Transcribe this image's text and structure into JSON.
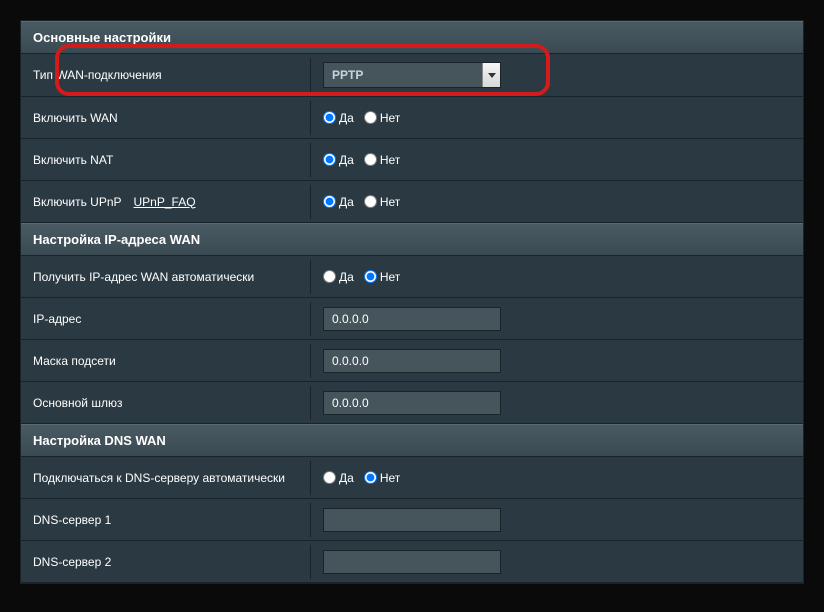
{
  "sections": {
    "basic": {
      "title": "Основные настройки",
      "rows": {
        "wan_type": {
          "label": "Тип WAN-подключения",
          "value": "PPTP"
        },
        "enable_wan": {
          "label": "Включить WAN",
          "yes": "Да",
          "no": "Нет"
        },
        "enable_nat": {
          "label": "Включить NAT",
          "yes": "Да",
          "no": "Нет"
        },
        "enable_upnp": {
          "label": "Включить UPnP",
          "faq_link": "UPnP_FAQ",
          "yes": "Да",
          "no": "Нет"
        }
      }
    },
    "wan_ip": {
      "title": "Настройка IP-адреса WAN",
      "rows": {
        "auto_ip": {
          "label": "Получить IP-адрес WAN автоматически",
          "yes": "Да",
          "no": "Нет"
        },
        "ip_address": {
          "label": "IP-адрес",
          "value": "0.0.0.0"
        },
        "subnet_mask": {
          "label": "Маска подсети",
          "value": "0.0.0.0"
        },
        "gateway": {
          "label": "Основной шлюз",
          "value": "0.0.0.0"
        }
      }
    },
    "dns": {
      "title": "Настройка DNS WAN",
      "rows": {
        "auto_dns": {
          "label": "Подключаться к DNS-серверу автоматически",
          "yes": "Да",
          "no": "Нет"
        },
        "dns1": {
          "label": "DNS-сервер 1",
          "value": ""
        },
        "dns2": {
          "label": "DNS-сервер 2",
          "value": ""
        }
      }
    }
  }
}
